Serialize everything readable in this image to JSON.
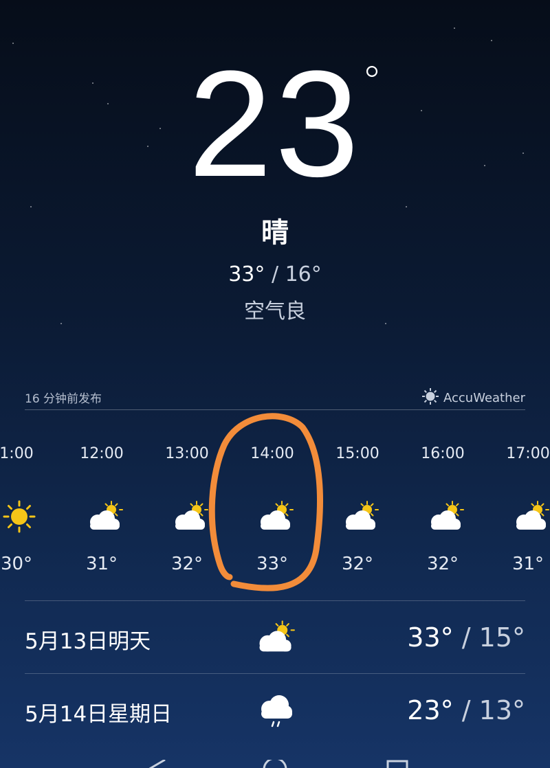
{
  "current": {
    "temperature": "23",
    "degree": "°",
    "condition": "晴",
    "high": "33°",
    "separator": "/",
    "low": "16°",
    "air_quality": "空气良"
  },
  "meta": {
    "published": "16 分钟前发布",
    "provider": "AccuWeather"
  },
  "hourly": [
    {
      "time": "1:00",
      "temp": "30°",
      "icon": "sun-icon"
    },
    {
      "time": "12:00",
      "temp": "31°",
      "icon": "partly-cloudy-icon"
    },
    {
      "time": "13:00",
      "temp": "32°",
      "icon": "partly-cloudy-icon"
    },
    {
      "time": "14:00",
      "temp": "33°",
      "icon": "partly-cloudy-icon"
    },
    {
      "time": "15:00",
      "temp": "32°",
      "icon": "partly-cloudy-icon"
    },
    {
      "time": "16:00",
      "temp": "32°",
      "icon": "partly-cloudy-icon"
    },
    {
      "time": "17:00",
      "temp": "31°",
      "icon": "partly-cloudy-icon"
    }
  ],
  "daily": [
    {
      "label": "5月13日明天",
      "high": "33°",
      "separator": "/",
      "low": "15°",
      "icon": "partly-cloudy-icon"
    },
    {
      "label": "5月14日星期日",
      "high": "23°",
      "separator": "/",
      "low": "13°",
      "icon": "rain-icon"
    }
  ],
  "colors": {
    "sun": "#f5c518",
    "cloud": "#ffffff",
    "highlight": "#f28c3a"
  }
}
